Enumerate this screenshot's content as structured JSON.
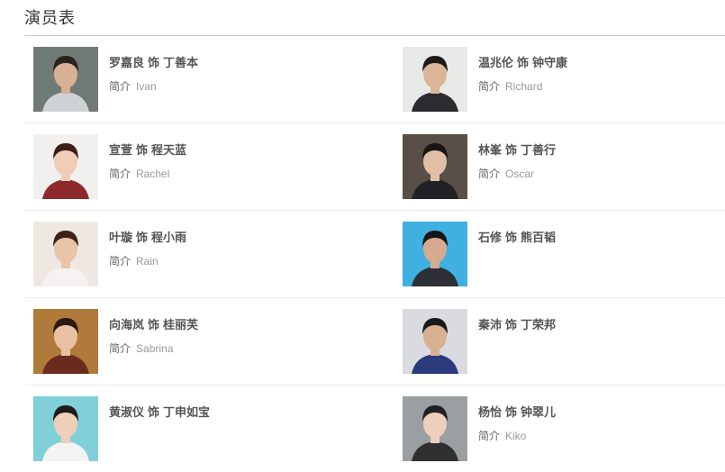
{
  "section": {
    "title": "演员表"
  },
  "cast": [
    {
      "actor": "罗嘉良",
      "role_word": "饰",
      "role": "丁善本",
      "intro_label": "简介",
      "english_name": "Ivan",
      "bg": "#6f7a74",
      "skin": "#d8b096",
      "hair": "#2a2420",
      "shirt": "#cfd2d4"
    },
    {
      "actor": "温兆伦",
      "role_word": "饰",
      "role": "钟守康",
      "intro_label": "简介",
      "english_name": "Richard",
      "bg": "#e7eae6",
      "skin": "#dcb598",
      "hair": "#1f1a17",
      "shirt": "#2b2b30"
    },
    {
      "actor": "宣萱",
      "role_word": "饰",
      "role": "程天蓝",
      "intro_label": "简介",
      "english_name": "Rachel",
      "bg": "#f2f0ee",
      "skin": "#f0cdb7",
      "hair": "#3a1f18",
      "shirt": "#8e2a2e"
    },
    {
      "actor": "林峯",
      "role_word": "饰",
      "role": "丁善行",
      "intro_label": "简介",
      "english_name": "Oscar",
      "bg": "#5a4f48",
      "skin": "#e0bfa6",
      "hair": "#1a1513",
      "shirt": "#222226"
    },
    {
      "actor": "叶璇",
      "role_word": "饰",
      "role": "程小雨",
      "intro_label": "简介",
      "english_name": "Rain",
      "bg": "#efe8e2",
      "skin": "#e9c4a9",
      "hair": "#3b2417",
      "shirt": "#f5f2ef"
    },
    {
      "actor": "石修",
      "role_word": "饰",
      "role": "熊百韬",
      "intro_label": "",
      "english_name": "",
      "bg": "#3fb0e0",
      "skin": "#d6aa8e",
      "hair": "#161616",
      "shirt": "#2d2f36"
    },
    {
      "actor": "向海岚",
      "role_word": "饰",
      "role": "桂丽芙",
      "intro_label": "简介",
      "english_name": "Sabrina",
      "bg": "#b07a3a",
      "skin": "#e8c2a0",
      "hair": "#2a1a12",
      "shirt": "#6b2a1e"
    },
    {
      "actor": "秦沛",
      "role_word": "饰",
      "role": "丁荣邦",
      "intro_label": "",
      "english_name": "",
      "bg": "#d9dbe0",
      "skin": "#d8b092",
      "hair": "#1a1a1a",
      "shirt": "#2a3a7a"
    },
    {
      "actor": "黄淑仪",
      "role_word": "饰",
      "role": "丁申如宝",
      "intro_label": "",
      "english_name": "",
      "bg": "#7fd0d8",
      "skin": "#efcfba",
      "hair": "#1f1b1a",
      "shirt": "#f4f4f4"
    },
    {
      "actor": "杨怡",
      "role_word": "饰",
      "role": "钟翠儿",
      "intro_label": "简介",
      "english_name": "Kiko",
      "bg": "#9aa0a2",
      "skin": "#ecd0bd",
      "hair": "#222022",
      "shirt": "#303030"
    }
  ]
}
